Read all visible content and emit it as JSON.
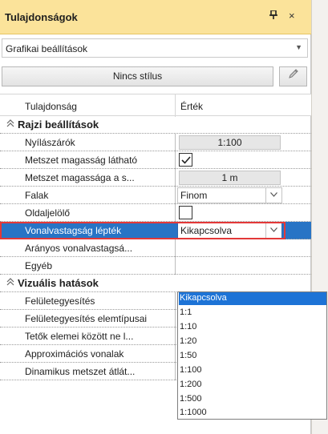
{
  "panel": {
    "title": "Tulajdonságok",
    "pin_glyph": "⊥",
    "close_glyph": "×",
    "dropdown_value": "Grafikai beállítások",
    "style_button": "Nincs stílus",
    "edit_icon": "pencil-icon"
  },
  "table": {
    "col_property": "Tulajdonság",
    "col_value": "Érték"
  },
  "rows": [
    {
      "type": "group",
      "name": "Rajzi beállítások"
    },
    {
      "type": "value",
      "name": "Nyílászárók",
      "value": "1:100"
    },
    {
      "type": "check",
      "name": "Metszet magasság látható",
      "checked": true
    },
    {
      "type": "value",
      "name": "Metszet magassága a s...",
      "value": "1 m"
    },
    {
      "type": "combo",
      "name": "Falak",
      "value": "Finom"
    },
    {
      "type": "check",
      "name": "Oldaljelölő",
      "checked": false
    },
    {
      "type": "combo",
      "name": "Vonalvastagság lépték",
      "value": "Kikapcsolva",
      "selected": true
    },
    {
      "type": "text",
      "name": "Arányos vonalvastagsá..."
    },
    {
      "type": "text",
      "name": "Egyéb"
    },
    {
      "type": "group",
      "name": "Vizuális hatások"
    },
    {
      "type": "text",
      "name": "Felületegyesítés"
    },
    {
      "type": "text",
      "name": "Felületegyesítés elemtípusai"
    },
    {
      "type": "text",
      "name": "Tetők elemei között ne l..."
    },
    {
      "type": "text",
      "name": "Approximációs vonalak"
    },
    {
      "type": "text",
      "name": "Dinamikus metszet átlát..."
    }
  ],
  "popup_options": [
    "Kikapcsolva",
    "1:1",
    "1:10",
    "1:20",
    "1:50",
    "1:100",
    "1:200",
    "1:500",
    "1:1000"
  ],
  "popup_highlighted": "Kikapcsolva"
}
